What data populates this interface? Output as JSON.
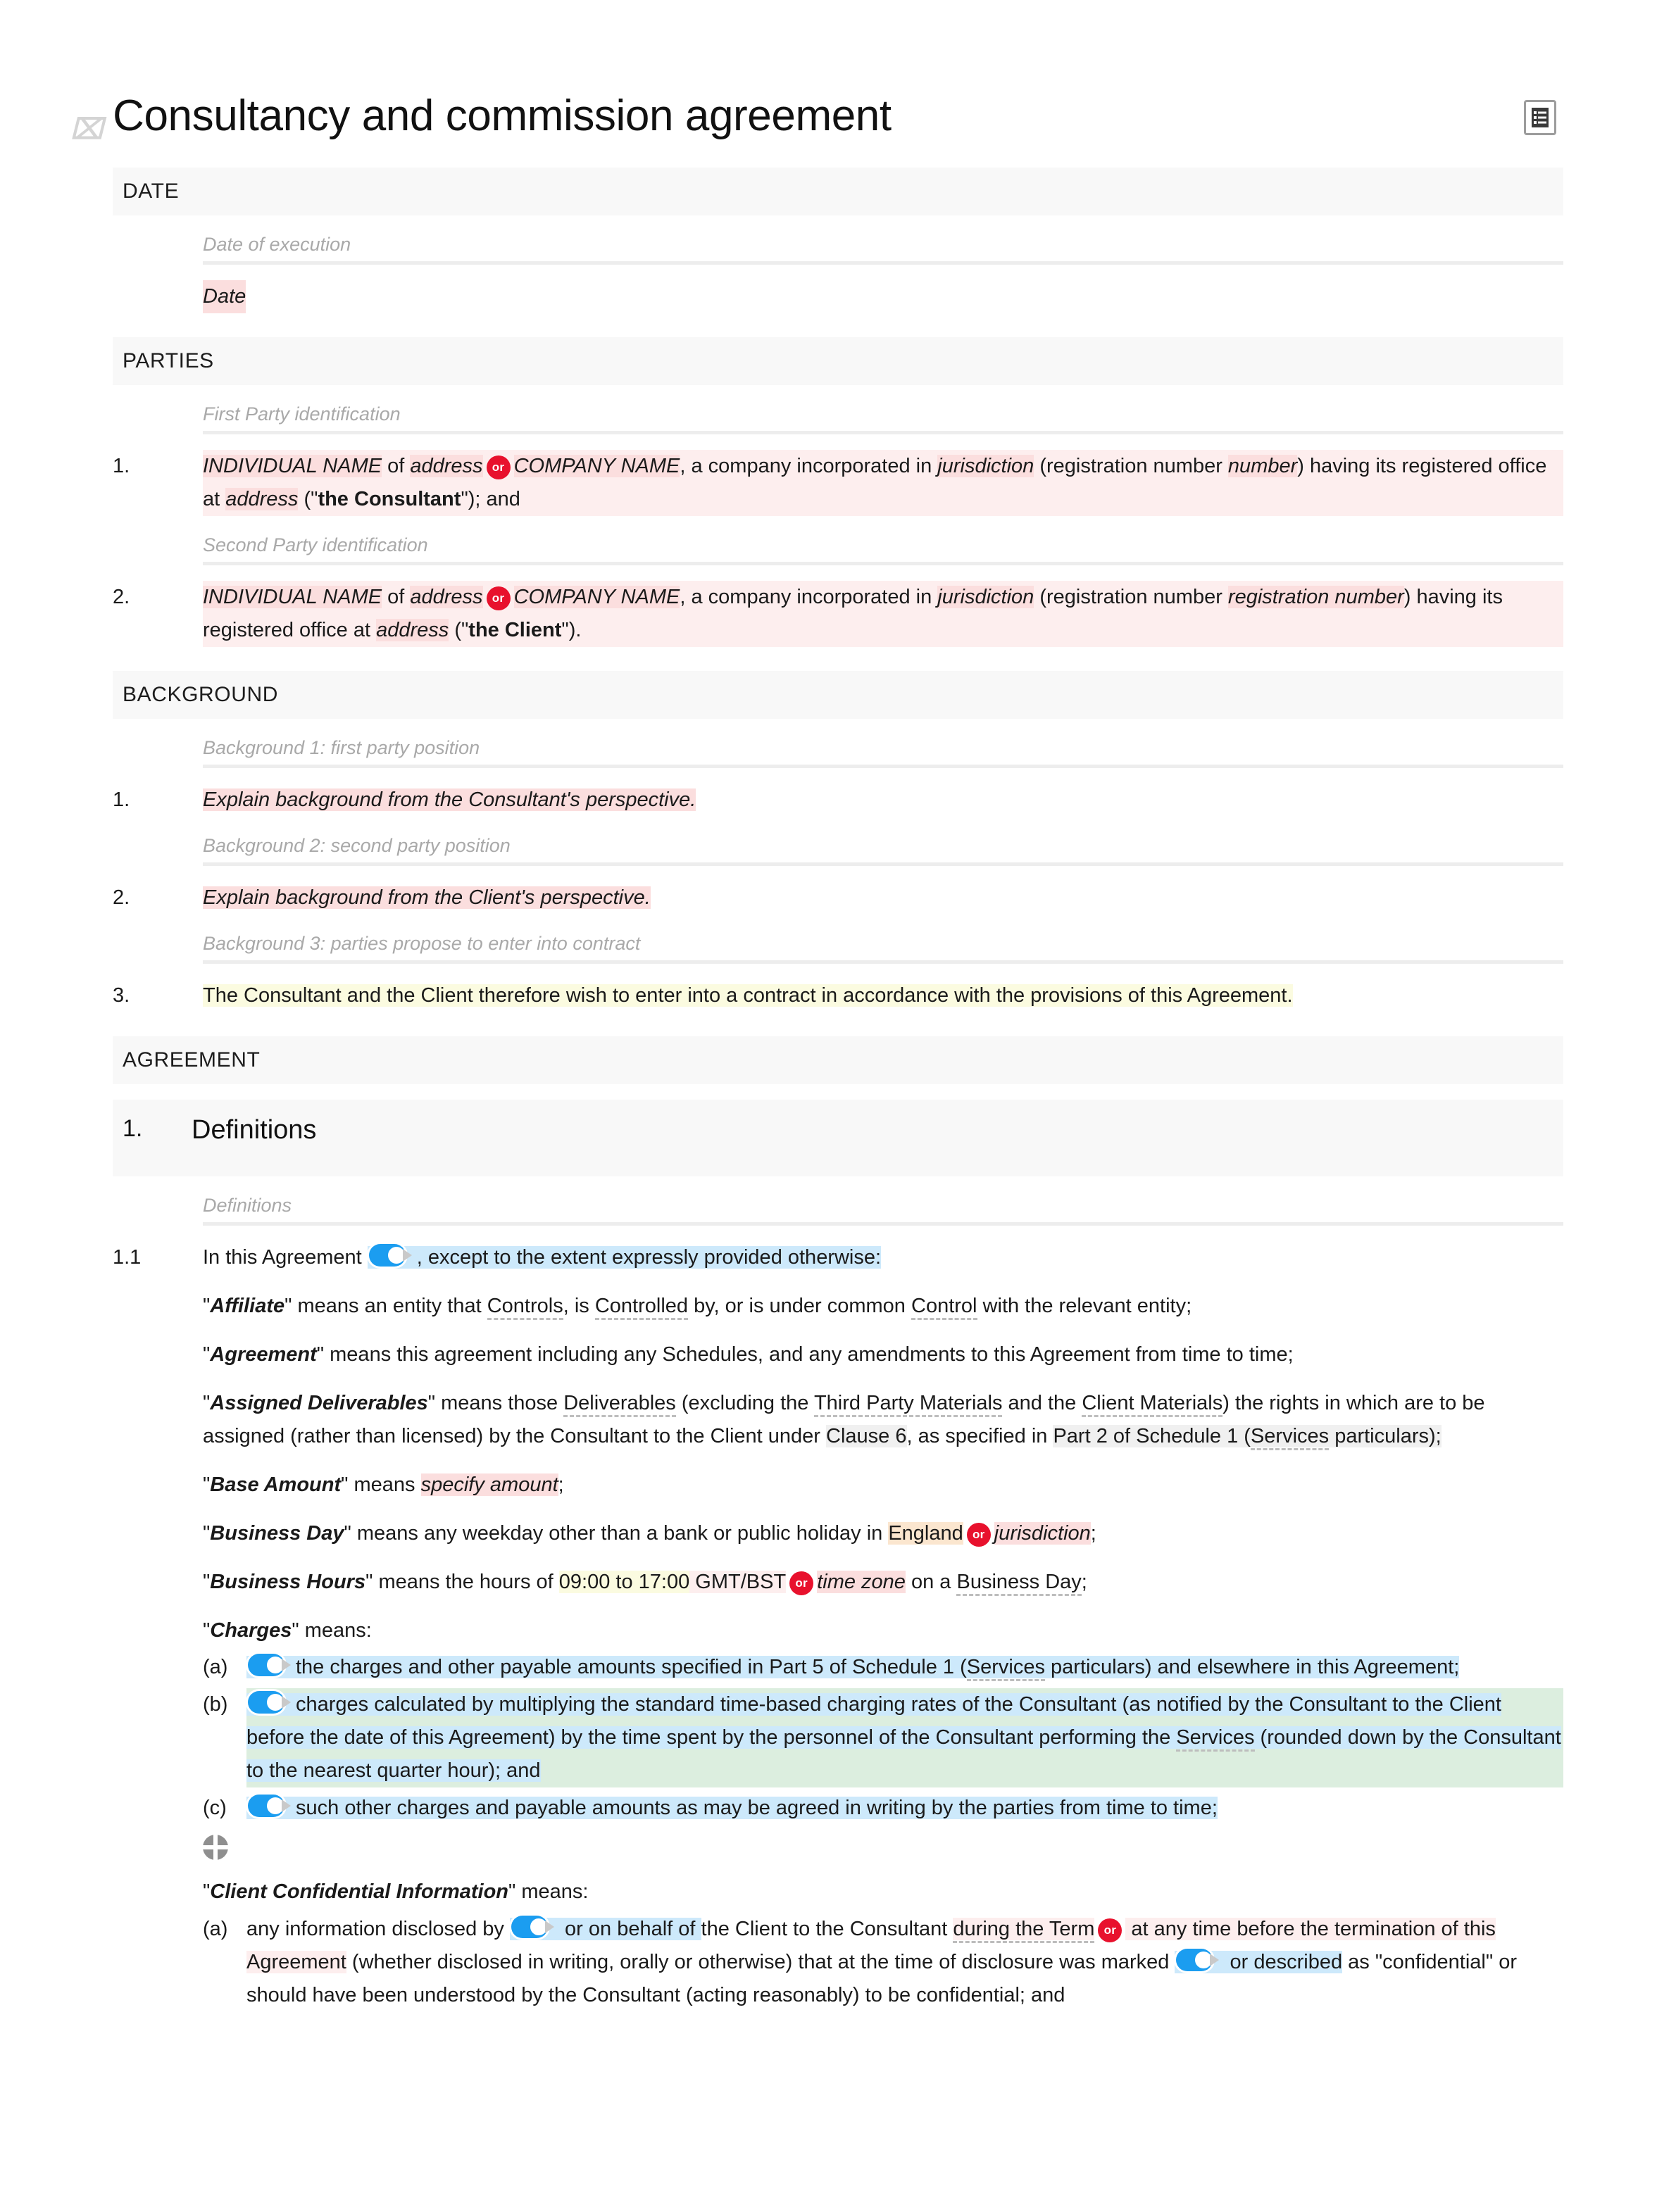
{
  "document": {
    "title": "Consultancy and commission agreement",
    "grip_glyph": "⌇",
    "toc_icon": "table-of-contents-icon"
  },
  "sections": {
    "date": {
      "heading": "DATE",
      "annotation": "Date of execution",
      "value": "Date"
    },
    "parties": {
      "heading": "PARTIES",
      "annotation_1": "First Party identification",
      "annotation_2": "Second Party identification",
      "party_1": {
        "number": "1.",
        "individual_name": "INDIVIDUAL NAME",
        "of": " of ",
        "address_1": "address",
        "or_badge": "or",
        "company_name": "COMPANY NAME",
        "incorporated": ", a company incorporated in ",
        "jurisdiction": "jurisdiction",
        "reg_open": " (registration number ",
        "reg_number": "number",
        "reg_close": ") having its registered office at ",
        "address_2": "address",
        "defined_open": " (\"",
        "defined_term": "the Consultant",
        "defined_close": "\"); and"
      },
      "party_2": {
        "number": "2.",
        "individual_name": "INDIVIDUAL NAME",
        "of": " of ",
        "address_1": "address",
        "or_badge": "or",
        "company_name": "COMPANY NAME",
        "incorporated": ", a company incorporated in ",
        "jurisdiction": "jurisdiction",
        "reg_open": " (registration number ",
        "reg_number": "registration number",
        "reg_close": ") having its registered office at ",
        "address_2": "address",
        "defined_open": " (\"",
        "defined_term": "the Client",
        "defined_close": "\")."
      }
    },
    "background": {
      "heading": "BACKGROUND",
      "items": [
        {
          "annotation": "Background 1: first party position",
          "number": "1.",
          "text": "Explain background from the Consultant's perspective."
        },
        {
          "annotation": "Background 2: second party position",
          "number": "2.",
          "text": "Explain background from the Client's perspective."
        },
        {
          "annotation": "Background 3: parties propose to enter into contract",
          "number": "3.",
          "text": "The Consultant and the Client therefore wish to enter into a contract in accordance with the provisions of this Agreement."
        }
      ]
    },
    "agreement": {
      "heading": "AGREEMENT",
      "clause": {
        "number": "1.",
        "title": "Definitions"
      },
      "annotation": "Definitions",
      "clause_1_1": {
        "number": "1.1",
        "lead_a": "In this Agreement",
        "lead_b": ", except to the extent expressly provided otherwise:"
      },
      "definitions": {
        "affiliate": {
          "term": "Affiliate",
          "t1": "\" means an entity that ",
          "controls": "Controls",
          "t2": ", is ",
          "controlled": "Controlled",
          "t3": " by, or is under common ",
          "control": "Control",
          "t4": " with the relevant entity;"
        },
        "agreement": {
          "term": "Agreement",
          "text": "\" means this agreement including any Schedules, and any amendments to this Agreement from time to time;"
        },
        "assigned_deliverables": {
          "term": "Assigned Deliverables",
          "t1": "\" means those ",
          "deliverables": "Deliverables",
          "t2": " (excluding the ",
          "third_party_materials": "Third Party Materials",
          "t3": " and the ",
          "client_materials": "Client Materials",
          "t4": ") the rights in which are to be assigned (rather than licensed) by the Consultant to the Client under ",
          "xref_clause": "Clause 6",
          "t5": ", as specified in ",
          "xref_part": "Part 2 of Schedule 1 (",
          "services": "Services",
          "xref_part_end": " particulars);"
        },
        "base_amount": {
          "term": "Base Amount",
          "t1": "\" means ",
          "placeholder": "specify amount",
          "t2": ";"
        },
        "business_day": {
          "term": "Business Day",
          "t1": "\" means any weekday other than a bank or public holiday in ",
          "england": "England",
          "or_badge": "or",
          "jurisdiction": "jurisdiction",
          "t2": ";"
        },
        "business_hours": {
          "term": "Business Hours",
          "t1": "\" means the hours of ",
          "from": "09:00",
          "to_word": " to ",
          "to": "17:00",
          "tz": " GMT/BST",
          "or_badge": "or",
          "time_zone": "time zone",
          "t2": " on a ",
          "business_day": "Business Day",
          "t3": ";"
        },
        "charges": {
          "term": "Charges",
          "t1": "\" means:",
          "items": [
            {
              "letter": "(a)",
              "t1": "the charges and other payable amounts specified in Part 5 of Schedule 1 (",
              "services": "Services",
              "t2": " particulars) and elsewhere in this Agreement;"
            },
            {
              "letter": "(b)",
              "t1": "charges calculated by multiplying the standard time-based charging rates of the Consultant (as notified by the Consultant to the Client before the date of this Agreement) by the time spent by the personnel of the Consultant performing the ",
              "services": "Services",
              "t2": " (rounded down by the Consultant to the nearest quarter hour); and"
            },
            {
              "letter": "(c)",
              "t1": "such other charges and payable amounts as may be agreed in writing by the parties from time to time;"
            }
          ],
          "move_handle": "move-handle-icon"
        },
        "client_confidential_information": {
          "term": "Client Confidential Information",
          "t1": "\" means:",
          "items": [
            {
              "letter": "(a)",
              "t1": "any information disclosed by ",
              "t2": " or on behalf of ",
              "t3": "the Client to the Consultant ",
              "during_term": "during the Term",
              "or_badge": "or",
              "t4": " at any time before the ",
              "termination": "termination of this Agreement",
              "t5": " (whether disclosed in writing, orally or otherwise) that at the time of disclosure was marked ",
              "t6": " or described",
              "t7": " as \"confidential\" or should have been understood by the Consultant (acting reasonably) to be confidential; and"
            }
          ]
        }
      }
    }
  },
  "colors": {
    "placeholder_highlight": "#fbdede",
    "clause_highlight": "#fdeeee",
    "optional_blue": "#cde9fb",
    "optional_green": "#dceedf",
    "note_yellow": "#fbfbe0",
    "variant_tan": "#fbe6cf",
    "xref_gray": "#f0f0f0",
    "toggle_blue": "#1b9df0",
    "or_badge_red": "#e8112d",
    "band_gray": "#f8f8f8"
  }
}
